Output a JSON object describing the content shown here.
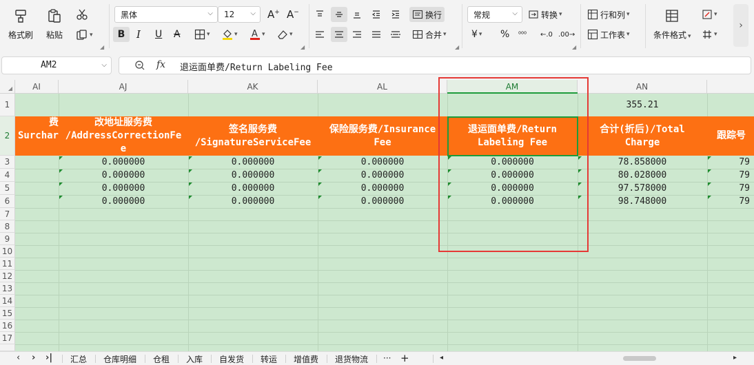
{
  "ribbon": {
    "format_painter": "格式刷",
    "paste": "粘贴",
    "paste_dropdown": "▾",
    "font_name": "黑体",
    "font_size": "12",
    "wrap_text": "换行",
    "number_format": "常规",
    "convert": "转换",
    "merge": "合并",
    "rows_cols": "行和列",
    "worksheet": "工作表",
    "conditional_format": "条件格式",
    "yuan_symbol": "¥",
    "percent_symbol": "%"
  },
  "formula_bar": {
    "cell_ref": "AM2",
    "fx": "fx",
    "content": "退运面单费/Return Labeling Fee"
  },
  "columns": [
    "AI",
    "AJ",
    "AK",
    "AL",
    "AM",
    "AN"
  ],
  "rows": [
    "1",
    "2",
    "3",
    "4",
    "5",
    "6",
    "7",
    "8",
    "9",
    "10",
    "11",
    "12",
    "13",
    "14",
    "15",
    "16",
    "17"
  ],
  "row1": {
    "an_value": "355.21"
  },
  "headers": {
    "ai": [
      "费",
      "Surchar"
    ],
    "aj": [
      "改地址服务费",
      "/AddressCorrectionFe",
      "e"
    ],
    "ak": [
      "签名服务费",
      "/SignatureServiceFee"
    ],
    "al": [
      "保险服务费/Insurance",
      "Fee"
    ],
    "am": [
      "退运面单费/Return",
      "Labeling Fee"
    ],
    "an": [
      "合计(折后)/Total",
      "Charge"
    ],
    "ao": [
      "跟踪号"
    ]
  },
  "data_rows": [
    {
      "aj": "0.000000",
      "ak": "0.000000",
      "al": "0.000000",
      "am": "0.000000",
      "an": "78.858000",
      "ao": "79"
    },
    {
      "aj": "0.000000",
      "ak": "0.000000",
      "al": "0.000000",
      "am": "0.000000",
      "an": "80.028000",
      "ao": "79"
    },
    {
      "aj": "0.000000",
      "ak": "0.000000",
      "al": "0.000000",
      "am": "0.000000",
      "an": "97.578000",
      "ao": "79"
    },
    {
      "aj": "0.000000",
      "ak": "0.000000",
      "al": "0.000000",
      "am": "0.000000",
      "an": "98.748000",
      "ao": "79"
    }
  ],
  "sheet_tabs": [
    "汇总",
    "仓库明细",
    "仓租",
    "入库",
    "自发货",
    "转运",
    "增值费",
    "退货物流"
  ],
  "tab_more": "···",
  "tab_add": "+",
  "colors": {
    "header_orange": "#fd7013",
    "cell_green": "#cde8cf",
    "select_green": "#1d9b3b",
    "annotation_red": "#e53935"
  }
}
